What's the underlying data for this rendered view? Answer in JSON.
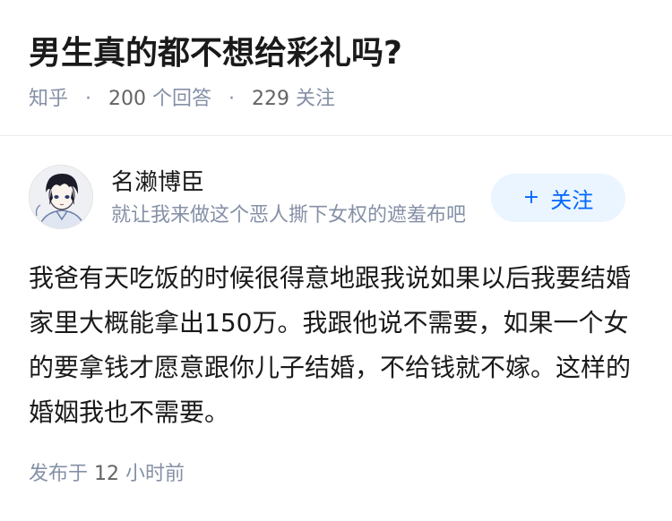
{
  "question": {
    "title": "男生真的都不想给彩礼吗?",
    "source": "知乎",
    "answer_count": "200",
    "answer_label": "个回答",
    "follower_count": "229",
    "follower_label": "关注",
    "separator": "·"
  },
  "author": {
    "name": "名濑博臣",
    "bio": "就让我来做这个恶人撕下女权的遮羞布吧",
    "follow_label": "关注",
    "follow_icon": "+"
  },
  "answer": {
    "text": "我爸有天吃饭的时候很得意地跟我说如果以后我要结婚家里大概能拿出150万。我跟他说不需要，如果一个女的要拿钱才愿意跟你儿子结婚，不给钱就不嫁。这样的婚姻我也不需要。",
    "published_label": "发布于",
    "published_time_num": "12",
    "published_time_unit": "小时前"
  },
  "colors": {
    "primary_text": "#1a1a1a",
    "secondary_text": "#8590a6",
    "accent": "#0066ff",
    "follow_bg": "#ebf5ff"
  }
}
